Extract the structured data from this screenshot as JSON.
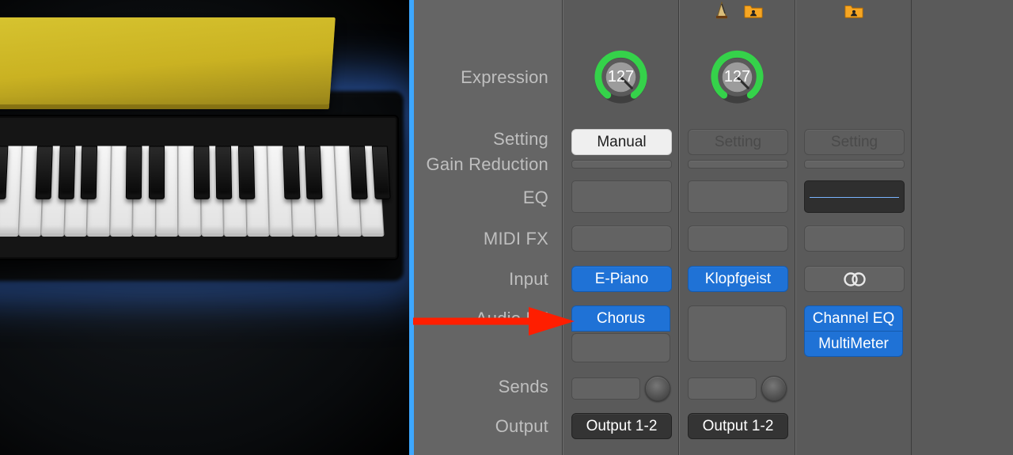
{
  "labels": {
    "expression": "Expression",
    "setting": "Setting",
    "gain_reduction": "Gain Reduction",
    "eq": "EQ",
    "midifx": "MIDI FX",
    "input": "Input",
    "audiofx": "Audio FX",
    "sends": "Sends",
    "output": "Output",
    "setting_placeholder": "Setting",
    "manual": "Manual"
  },
  "strips": [
    {
      "name": "track-epiano",
      "icons": [],
      "expression_value": "127",
      "setting": "Manual",
      "setting_style": "manual",
      "eq_dark": false,
      "input": "E-Piano",
      "input_style": "blue",
      "audio_fx": [
        "Chorus"
      ],
      "sends_has_knob": true,
      "output": "Output 1-2"
    },
    {
      "name": "track-klopfgeist",
      "icons": [
        "metronome-icon",
        "user-folder-icon"
      ],
      "expression_value": "127",
      "setting": "Setting",
      "setting_style": "placeholder",
      "eq_dark": false,
      "input": "Klopfgeist",
      "input_style": "blue",
      "audio_fx": [],
      "sends_has_knob": true,
      "output": "Output 1-2"
    },
    {
      "name": "track-stereo-out",
      "icons": [
        "user-folder-icon"
      ],
      "expression_value": "",
      "setting": "Setting",
      "setting_style": "placeholder",
      "eq_dark": true,
      "input": "stereo-icon",
      "input_style": "icon",
      "audio_fx": [
        "Channel EQ",
        "MultiMeter"
      ],
      "sends_has_knob": false,
      "output": ""
    }
  ],
  "annotation": {
    "arrow_points_to": "audiofx-row"
  }
}
